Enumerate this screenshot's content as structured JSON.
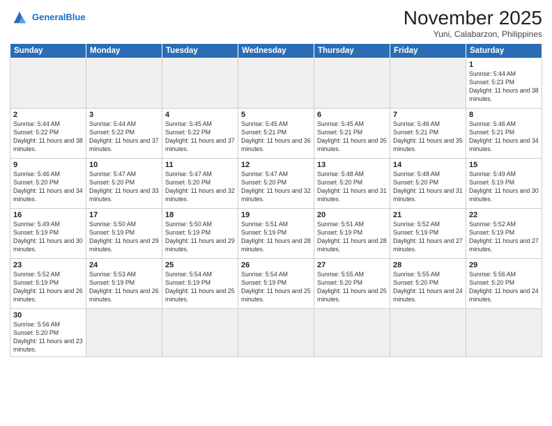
{
  "header": {
    "logo_general": "General",
    "logo_blue": "Blue",
    "month_title": "November 2025",
    "location": "Yuni, Calabarzon, Philippines"
  },
  "days_of_week": [
    "Sunday",
    "Monday",
    "Tuesday",
    "Wednesday",
    "Thursday",
    "Friday",
    "Saturday"
  ],
  "weeks": [
    [
      {
        "day": "",
        "empty": true
      },
      {
        "day": "",
        "empty": true
      },
      {
        "day": "",
        "empty": true
      },
      {
        "day": "",
        "empty": true
      },
      {
        "day": "",
        "empty": true
      },
      {
        "day": "",
        "empty": true
      },
      {
        "day": "1",
        "sunrise": "5:44 AM",
        "sunset": "5:23 PM",
        "daylight": "11 hours and 38 minutes."
      }
    ],
    [
      {
        "day": "2",
        "sunrise": "5:44 AM",
        "sunset": "5:22 PM",
        "daylight": "11 hours and 38 minutes."
      },
      {
        "day": "3",
        "sunrise": "5:44 AM",
        "sunset": "5:22 PM",
        "daylight": "11 hours and 37 minutes."
      },
      {
        "day": "4",
        "sunrise": "5:45 AM",
        "sunset": "5:22 PM",
        "daylight": "11 hours and 37 minutes."
      },
      {
        "day": "5",
        "sunrise": "5:45 AM",
        "sunset": "5:21 PM",
        "daylight": "11 hours and 36 minutes."
      },
      {
        "day": "6",
        "sunrise": "5:45 AM",
        "sunset": "5:21 PM",
        "daylight": "11 hours and 35 minutes."
      },
      {
        "day": "7",
        "sunrise": "5:46 AM",
        "sunset": "5:21 PM",
        "daylight": "11 hours and 35 minutes."
      },
      {
        "day": "8",
        "sunrise": "5:46 AM",
        "sunset": "5:21 PM",
        "daylight": "11 hours and 34 minutes."
      }
    ],
    [
      {
        "day": "9",
        "sunrise": "5:46 AM",
        "sunset": "5:20 PM",
        "daylight": "11 hours and 34 minutes."
      },
      {
        "day": "10",
        "sunrise": "5:47 AM",
        "sunset": "5:20 PM",
        "daylight": "11 hours and 33 minutes."
      },
      {
        "day": "11",
        "sunrise": "5:47 AM",
        "sunset": "5:20 PM",
        "daylight": "11 hours and 32 minutes."
      },
      {
        "day": "12",
        "sunrise": "5:47 AM",
        "sunset": "5:20 PM",
        "daylight": "11 hours and 32 minutes."
      },
      {
        "day": "13",
        "sunrise": "5:48 AM",
        "sunset": "5:20 PM",
        "daylight": "11 hours and 31 minutes."
      },
      {
        "day": "14",
        "sunrise": "5:48 AM",
        "sunset": "5:20 PM",
        "daylight": "11 hours and 31 minutes."
      },
      {
        "day": "15",
        "sunrise": "5:49 AM",
        "sunset": "5:19 PM",
        "daylight": "11 hours and 30 minutes."
      }
    ],
    [
      {
        "day": "16",
        "sunrise": "5:49 AM",
        "sunset": "5:19 PM",
        "daylight": "11 hours and 30 minutes."
      },
      {
        "day": "17",
        "sunrise": "5:50 AM",
        "sunset": "5:19 PM",
        "daylight": "11 hours and 29 minutes."
      },
      {
        "day": "18",
        "sunrise": "5:50 AM",
        "sunset": "5:19 PM",
        "daylight": "11 hours and 29 minutes."
      },
      {
        "day": "19",
        "sunrise": "5:51 AM",
        "sunset": "5:19 PM",
        "daylight": "11 hours and 28 minutes."
      },
      {
        "day": "20",
        "sunrise": "5:51 AM",
        "sunset": "5:19 PM",
        "daylight": "11 hours and 28 minutes."
      },
      {
        "day": "21",
        "sunrise": "5:52 AM",
        "sunset": "5:19 PM",
        "daylight": "11 hours and 27 minutes."
      },
      {
        "day": "22",
        "sunrise": "5:52 AM",
        "sunset": "5:19 PM",
        "daylight": "11 hours and 27 minutes."
      }
    ],
    [
      {
        "day": "23",
        "sunrise": "5:52 AM",
        "sunset": "5:19 PM",
        "daylight": "11 hours and 26 minutes."
      },
      {
        "day": "24",
        "sunrise": "5:53 AM",
        "sunset": "5:19 PM",
        "daylight": "11 hours and 26 minutes."
      },
      {
        "day": "25",
        "sunrise": "5:54 AM",
        "sunset": "5:19 PM",
        "daylight": "11 hours and 25 minutes."
      },
      {
        "day": "26",
        "sunrise": "5:54 AM",
        "sunset": "5:19 PM",
        "daylight": "11 hours and 25 minutes."
      },
      {
        "day": "27",
        "sunrise": "5:55 AM",
        "sunset": "5:20 PM",
        "daylight": "11 hours and 25 minutes."
      },
      {
        "day": "28",
        "sunrise": "5:55 AM",
        "sunset": "5:20 PM",
        "daylight": "11 hours and 24 minutes."
      },
      {
        "day": "29",
        "sunrise": "5:56 AM",
        "sunset": "5:20 PM",
        "daylight": "11 hours and 24 minutes."
      }
    ],
    [
      {
        "day": "30",
        "sunrise": "5:56 AM",
        "sunset": "5:20 PM",
        "daylight": "11 hours and 23 minutes.",
        "last": true
      },
      {
        "day": "",
        "empty": true,
        "last": true
      },
      {
        "day": "",
        "empty": true,
        "last": true
      },
      {
        "day": "",
        "empty": true,
        "last": true
      },
      {
        "day": "",
        "empty": true,
        "last": true
      },
      {
        "day": "",
        "empty": true,
        "last": true
      },
      {
        "day": "",
        "empty": true,
        "last": true
      }
    ]
  ],
  "labels": {
    "sunrise": "Sunrise:",
    "sunset": "Sunset:",
    "daylight": "Daylight:"
  }
}
